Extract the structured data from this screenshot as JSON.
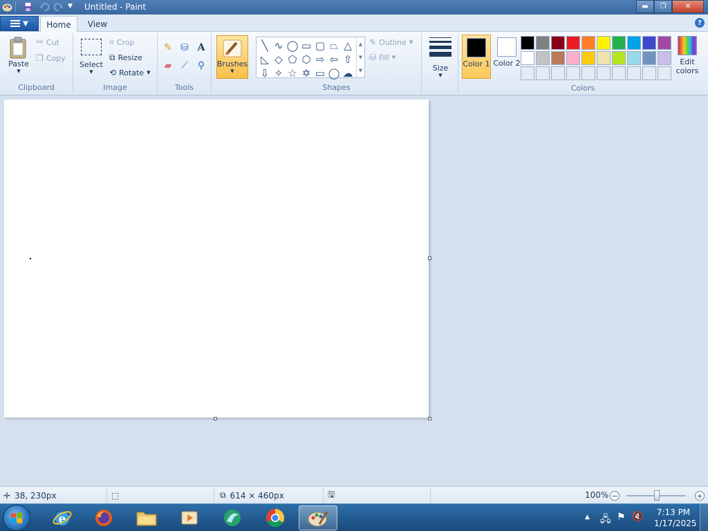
{
  "window": {
    "title": "Untitled - Paint",
    "minimize_icon": "minimize-icon",
    "maximize_icon": "restore-icon",
    "close_icon": "close-icon"
  },
  "tabs": {
    "home": "Home",
    "view": "View"
  },
  "ribbon": {
    "clipboard": {
      "label": "Clipboard",
      "paste": "Paste",
      "cut": "Cut",
      "copy": "Copy"
    },
    "image": {
      "label": "Image",
      "select": "Select",
      "crop": "Crop",
      "resize": "Resize",
      "rotate": "Rotate"
    },
    "tools": {
      "label": "Tools"
    },
    "brushes": {
      "label": "Brushes"
    },
    "shapes": {
      "label": "Shapes",
      "outline": "Outline",
      "fill": "Fill"
    },
    "size": {
      "label": "Size"
    },
    "colors": {
      "label": "Colors",
      "color1": "Color 1",
      "color2": "Color 2",
      "color1_value": "#000000",
      "color2_value": "#ffffff",
      "edit_colors": "Edit colors",
      "palette": [
        "#000000",
        "#7f7f7f",
        "#880015",
        "#ed1c24",
        "#ff7f27",
        "#fff200",
        "#22b14c",
        "#00a2e8",
        "#3f48cc",
        "#a349a4",
        "#ffffff",
        "#c3c3c3",
        "#b97a57",
        "#ffaec9",
        "#ffc90e",
        "#efe4b0",
        "#b5e61d",
        "#99d9ea",
        "#7092be",
        "#c8bfe7",
        "#e4ebf4",
        "#e4ebf4",
        "#e4ebf4",
        "#e4ebf4",
        "#e4ebf4",
        "#e4ebf4",
        "#e4ebf4",
        "#e4ebf4",
        "#e4ebf4",
        "#e4ebf4"
      ]
    }
  },
  "status": {
    "cursor_pos": "38, 230px",
    "selection_size": "",
    "canvas_size": "614 × 460px",
    "zoom": "100%"
  },
  "taskbar": {
    "time": "7:13 PM",
    "date": "1/17/2025",
    "apps": [
      "internet-explorer-icon",
      "firefox-icon",
      "file-explorer-icon",
      "media-player-icon",
      "network-app-icon",
      "chrome-icon",
      "paint-icon"
    ]
  }
}
